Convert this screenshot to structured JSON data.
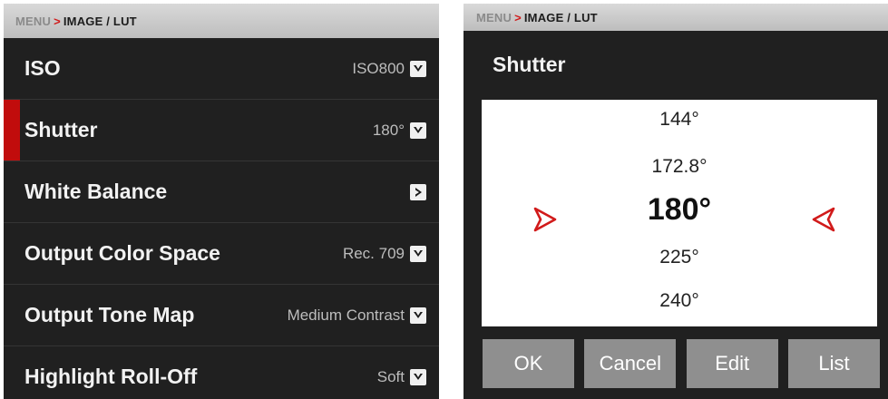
{
  "left": {
    "breadcrumb": {
      "root": "MENU",
      "sep": ">",
      "current": "IMAGE / LUT"
    },
    "rows": [
      {
        "label": "ISO",
        "value": "ISO800",
        "control": "dropdown"
      },
      {
        "label": "Shutter",
        "value": "180°",
        "control": "dropdown",
        "active": true
      },
      {
        "label": "White Balance",
        "value": "",
        "control": "submenu"
      },
      {
        "label": "Output Color Space",
        "value": "Rec. 709",
        "control": "dropdown"
      },
      {
        "label": "Output Tone Map",
        "value": "Medium Contrast",
        "control": "dropdown"
      },
      {
        "label": "Highlight Roll-Off",
        "value": "Soft",
        "control": "dropdown"
      }
    ]
  },
  "right": {
    "breadcrumb": {
      "root": "MENU",
      "sep": ">",
      "current": "IMAGE / LUT"
    },
    "title": "Shutter",
    "picker": {
      "items": [
        "144°",
        "172.8°",
        "180°",
        "225°",
        "240°"
      ],
      "selected_index": 2
    },
    "buttons": {
      "ok": "OK",
      "cancel": "Cancel",
      "edit": "Edit",
      "list": "List"
    }
  },
  "colors": {
    "accent": "#c10c0c",
    "panel_bg": "#202020",
    "button_bg": "#8f8f8f"
  },
  "icons": {
    "dropdown": "chevron-down-icon",
    "submenu": "chevron-right-icon",
    "picker_left": "arrow-right-icon",
    "picker_right": "arrow-left-icon"
  }
}
